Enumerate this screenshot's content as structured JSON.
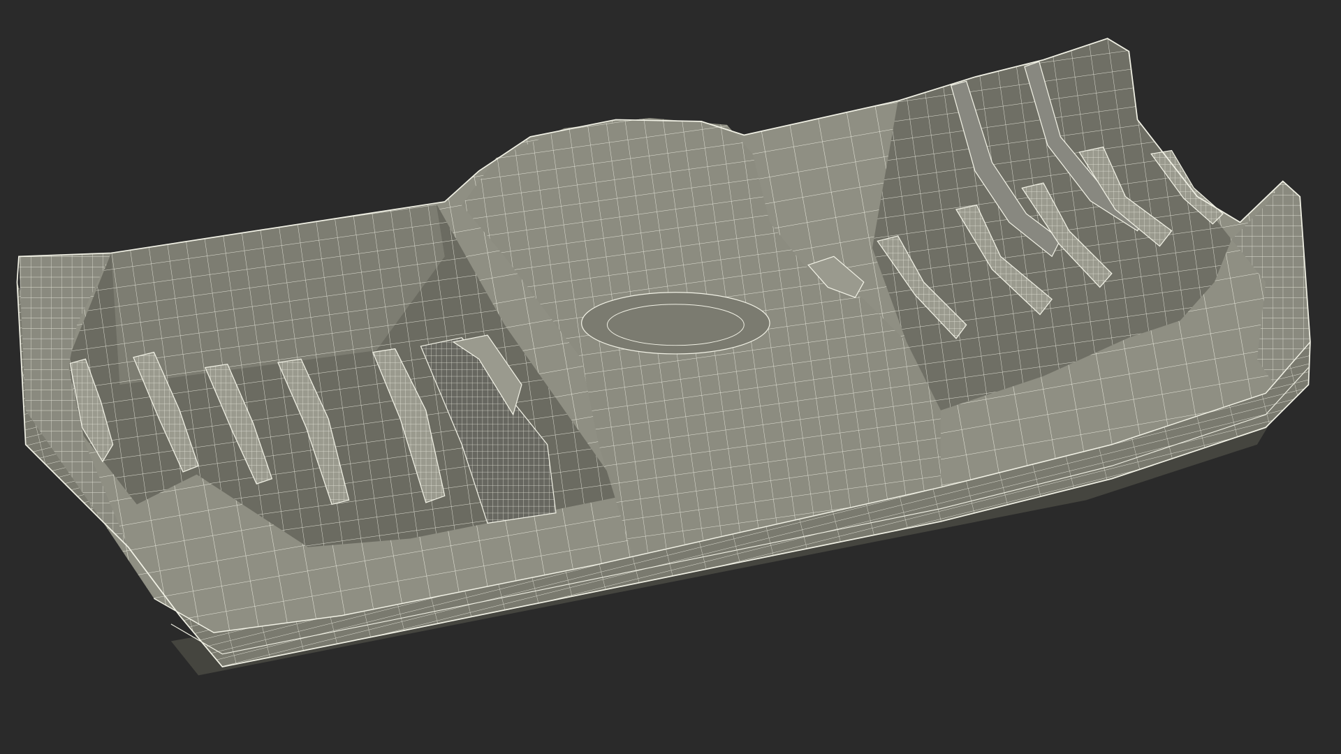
{
  "colors": {
    "background": "#2a2a2a",
    "surface_light": "#8f8f83",
    "surface_mid": "#7a7a6f",
    "surface_dark": "#5c5c54",
    "surface_shadow": "#45453f",
    "wire": "#f2f2e6"
  },
  "object": {
    "icon": "wireframe-mesh-icon"
  }
}
